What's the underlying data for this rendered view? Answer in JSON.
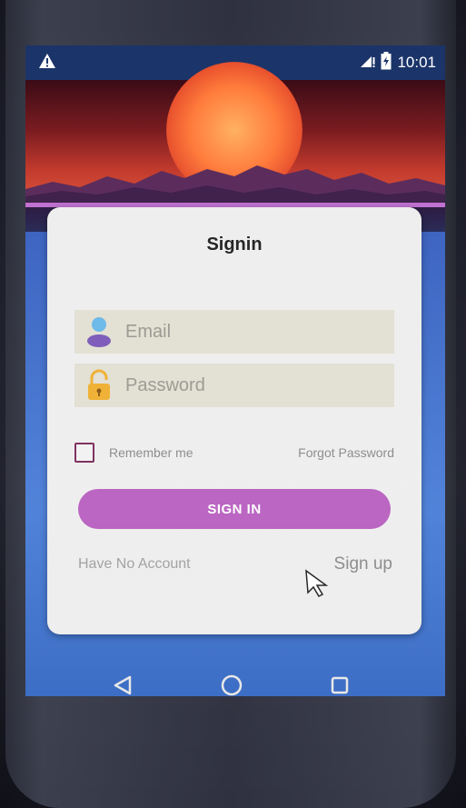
{
  "statusbar": {
    "warning_icon": "warning-icon",
    "signal_icon": "signal-icon",
    "battery_icon": "battery-icon",
    "time": "10:01"
  },
  "card": {
    "title": "Signin",
    "email": {
      "placeholder": "Email",
      "icon": "user-icon"
    },
    "password": {
      "placeholder": "Password",
      "icon": "lock-icon"
    },
    "remember_label": "Remember me",
    "forgot_label": "Forgot Password",
    "signin_label": "SIGN IN",
    "no_account_label": "Have No Account",
    "signup_label": "Sign up"
  },
  "navbar": {
    "back_icon": "back-triangle-icon",
    "home_icon": "home-circle-icon",
    "recents_icon": "recents-square-icon"
  },
  "colors": {
    "accent": "#b860c0",
    "statusbar": "#1a3368",
    "card_bg": "#eeeeee",
    "field_bg": "#e2dfd3"
  }
}
